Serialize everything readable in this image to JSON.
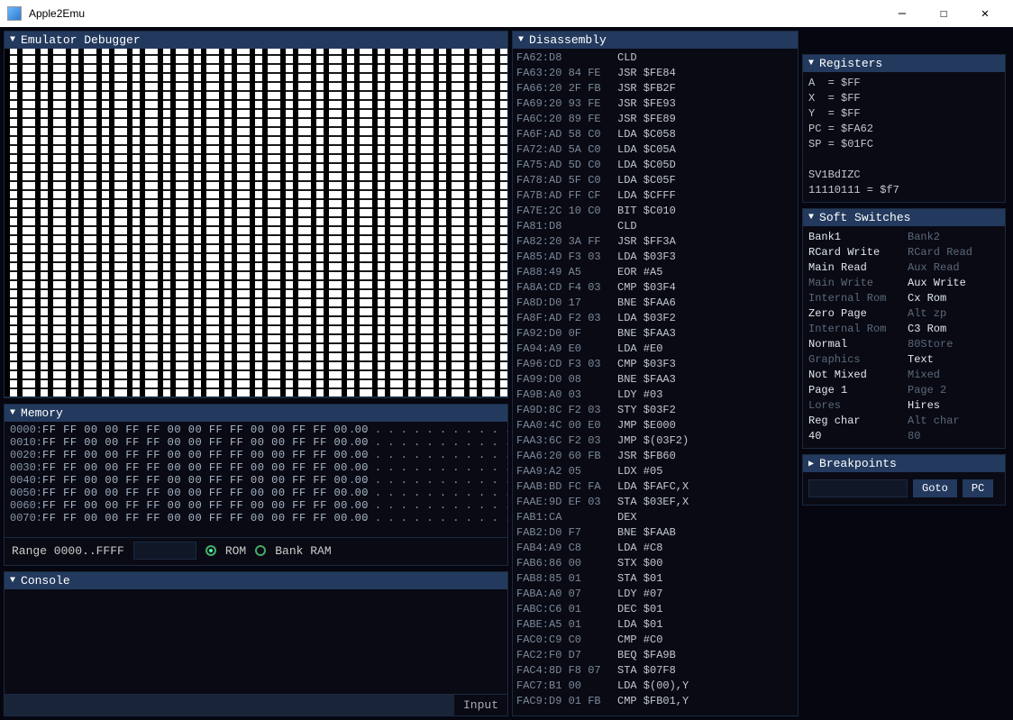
{
  "window": {
    "title": "Apple2Emu"
  },
  "panels": {
    "debugger": "Emulator Debugger",
    "memory": "Memory",
    "console": "Console",
    "disassembly": "Disassembly",
    "registers": "Registers",
    "soft_switches": "Soft Switches",
    "breakpoints": "Breakpoints"
  },
  "memory": {
    "range_label": "Range 0000..FFFF",
    "rom_label": "ROM",
    "bankram_label": "Bank RAM",
    "rows": [
      {
        "addr": "0000:",
        "hex": "FF FF 00 00 FF FF 00 00 FF FF 00 00 FF FF 00 00",
        "ascii": ". . . . . . . . . . . . . . . ."
      },
      {
        "addr": "0010:",
        "hex": "FF FF 00 00 FF FF 00 00 FF FF 00 00 FF FF 00 00",
        "ascii": ". . . . . . . . . . . . . . . ."
      },
      {
        "addr": "0020:",
        "hex": "FF FF 00 00 FF FF 00 00 FF FF 00 00 FF FF 00 00",
        "ascii": ". . . . . . . . . . . . . . . ."
      },
      {
        "addr": "0030:",
        "hex": "FF FF 00 00 FF FF 00 00 FF FF 00 00 FF FF 00 00",
        "ascii": ". . . . . . . . . . . . . . . ."
      },
      {
        "addr": "0040:",
        "hex": "FF FF 00 00 FF FF 00 00 FF FF 00 00 FF FF 00 00",
        "ascii": ". . . . . . . . . . . . . . . ."
      },
      {
        "addr": "0050:",
        "hex": "FF FF 00 00 FF FF 00 00 FF FF 00 00 FF FF 00 00",
        "ascii": ". . . . . . . . . . . . . . . ."
      },
      {
        "addr": "0060:",
        "hex": "FF FF 00 00 FF FF 00 00 FF FF 00 00 FF FF 00 00",
        "ascii": ". . . . . . . . . . . . . . . ."
      },
      {
        "addr": "0070:",
        "hex": "FF FF 00 00 FF FF 00 00 FF FF 00 00 FF FF 00 00",
        "ascii": ". . . . . . . . . . . . . . . ."
      }
    ]
  },
  "console": {
    "input_label": "Input"
  },
  "disassembly": [
    {
      "addr": "FA62:D8",
      "mnem": "CLD"
    },
    {
      "addr": "FA63:20 84 FE",
      "mnem": "JSR $FE84"
    },
    {
      "addr": "FA66:20 2F FB",
      "mnem": "JSR $FB2F"
    },
    {
      "addr": "FA69:20 93 FE",
      "mnem": "JSR $FE93"
    },
    {
      "addr": "FA6C:20 89 FE",
      "mnem": "JSR $FE89"
    },
    {
      "addr": "FA6F:AD 58 C0",
      "mnem": "LDA $C058"
    },
    {
      "addr": "FA72:AD 5A C0",
      "mnem": "LDA $C05A"
    },
    {
      "addr": "FA75:AD 5D C0",
      "mnem": "LDA $C05D"
    },
    {
      "addr": "FA78:AD 5F C0",
      "mnem": "LDA $C05F"
    },
    {
      "addr": "FA7B:AD FF CF",
      "mnem": "LDA $CFFF"
    },
    {
      "addr": "FA7E:2C 10 C0",
      "mnem": "BIT $C010"
    },
    {
      "addr": "FA81:D8",
      "mnem": "CLD"
    },
    {
      "addr": "FA82:20 3A FF",
      "mnem": "JSR $FF3A"
    },
    {
      "addr": "FA85:AD F3 03",
      "mnem": "LDA $03F3"
    },
    {
      "addr": "FA88:49 A5",
      "mnem": "EOR #A5"
    },
    {
      "addr": "FA8A:CD F4 03",
      "mnem": "CMP $03F4"
    },
    {
      "addr": "FA8D:D0 17",
      "mnem": "BNE $FAA6"
    },
    {
      "addr": "FA8F:AD F2 03",
      "mnem": "LDA $03F2"
    },
    {
      "addr": "FA92:D0 0F",
      "mnem": "BNE $FAA3"
    },
    {
      "addr": "FA94:A9 E0",
      "mnem": "LDA #E0"
    },
    {
      "addr": "FA96:CD F3 03",
      "mnem": "CMP $03F3"
    },
    {
      "addr": "FA99:D0 08",
      "mnem": "BNE $FAA3"
    },
    {
      "addr": "FA9B:A0 03",
      "mnem": "LDY #03"
    },
    {
      "addr": "FA9D:8C F2 03",
      "mnem": "STY $03F2"
    },
    {
      "addr": "FAA0:4C 00 E0",
      "mnem": "JMP $E000"
    },
    {
      "addr": "FAA3:6C F2 03",
      "mnem": "JMP $(03F2)"
    },
    {
      "addr": "FAA6:20 60 FB",
      "mnem": "JSR $FB60"
    },
    {
      "addr": "FAA9:A2 05",
      "mnem": "LDX #05"
    },
    {
      "addr": "FAAB:BD FC FA",
      "mnem": "LDA $FAFC,X"
    },
    {
      "addr": "FAAE:9D EF 03",
      "mnem": "STA $03EF,X"
    },
    {
      "addr": "FAB1:CA",
      "mnem": "DEX"
    },
    {
      "addr": "FAB2:D0 F7",
      "mnem": "BNE $FAAB"
    },
    {
      "addr": "FAB4:A9 C8",
      "mnem": "LDA #C8"
    },
    {
      "addr": "FAB6:86 00",
      "mnem": "STX $00"
    },
    {
      "addr": "FAB8:85 01",
      "mnem": "STA $01"
    },
    {
      "addr": "FABA:A0 07",
      "mnem": "LDY #07"
    },
    {
      "addr": "FABC:C6 01",
      "mnem": "DEC $01"
    },
    {
      "addr": "FABE:A5 01",
      "mnem": "LDA $01"
    },
    {
      "addr": "FAC0:C9 C0",
      "mnem": "CMP #C0"
    },
    {
      "addr": "FAC2:F0 D7",
      "mnem": "BEQ $FA9B"
    },
    {
      "addr": "FAC4:8D F8 07",
      "mnem": "STA $07F8"
    },
    {
      "addr": "FAC7:B1 00",
      "mnem": "LDA $(00),Y"
    },
    {
      "addr": "FAC9:D9 01 FB",
      "mnem": "CMP $FB01,Y"
    }
  ],
  "registers": {
    "lines": [
      "A  = $FF",
      "X  = $FF",
      "Y  = $FF",
      "PC = $FA62",
      "SP = $01FC",
      "",
      "SV1BdIZC",
      "11110111 = $f7"
    ]
  },
  "soft_switches": [
    {
      "left": "Bank1",
      "la": true,
      "right": "Bank2",
      "ra": false
    },
    {
      "left": "RCard Write",
      "la": true,
      "right": "RCard Read",
      "ra": false
    },
    {
      "left": "Main Read",
      "la": true,
      "right": "Aux Read",
      "ra": false
    },
    {
      "left": "Main Write",
      "la": false,
      "right": "Aux Write",
      "ra": true
    },
    {
      "left": "Internal Rom",
      "la": false,
      "right": "Cx Rom",
      "ra": true
    },
    {
      "left": "Zero Page",
      "la": true,
      "right": "Alt zp",
      "ra": false
    },
    {
      "left": "Internal Rom",
      "la": false,
      "right": "C3 Rom",
      "ra": true
    },
    {
      "left": "Normal",
      "la": true,
      "right": "80Store",
      "ra": false
    },
    {
      "left": "Graphics",
      "la": false,
      "right": "Text",
      "ra": true
    },
    {
      "left": "Not Mixed",
      "la": true,
      "right": "Mixed",
      "ra": false
    },
    {
      "left": "Page 1",
      "la": true,
      "right": "Page 2",
      "ra": false
    },
    {
      "left": "Lores",
      "la": false,
      "right": "Hires",
      "ra": true
    },
    {
      "left": "Reg char",
      "la": true,
      "right": "Alt char",
      "ra": false
    },
    {
      "left": "40",
      "la": true,
      "right": "80",
      "ra": false
    }
  ],
  "breakpoints": {
    "goto": "Goto",
    "pc": "PC"
  }
}
